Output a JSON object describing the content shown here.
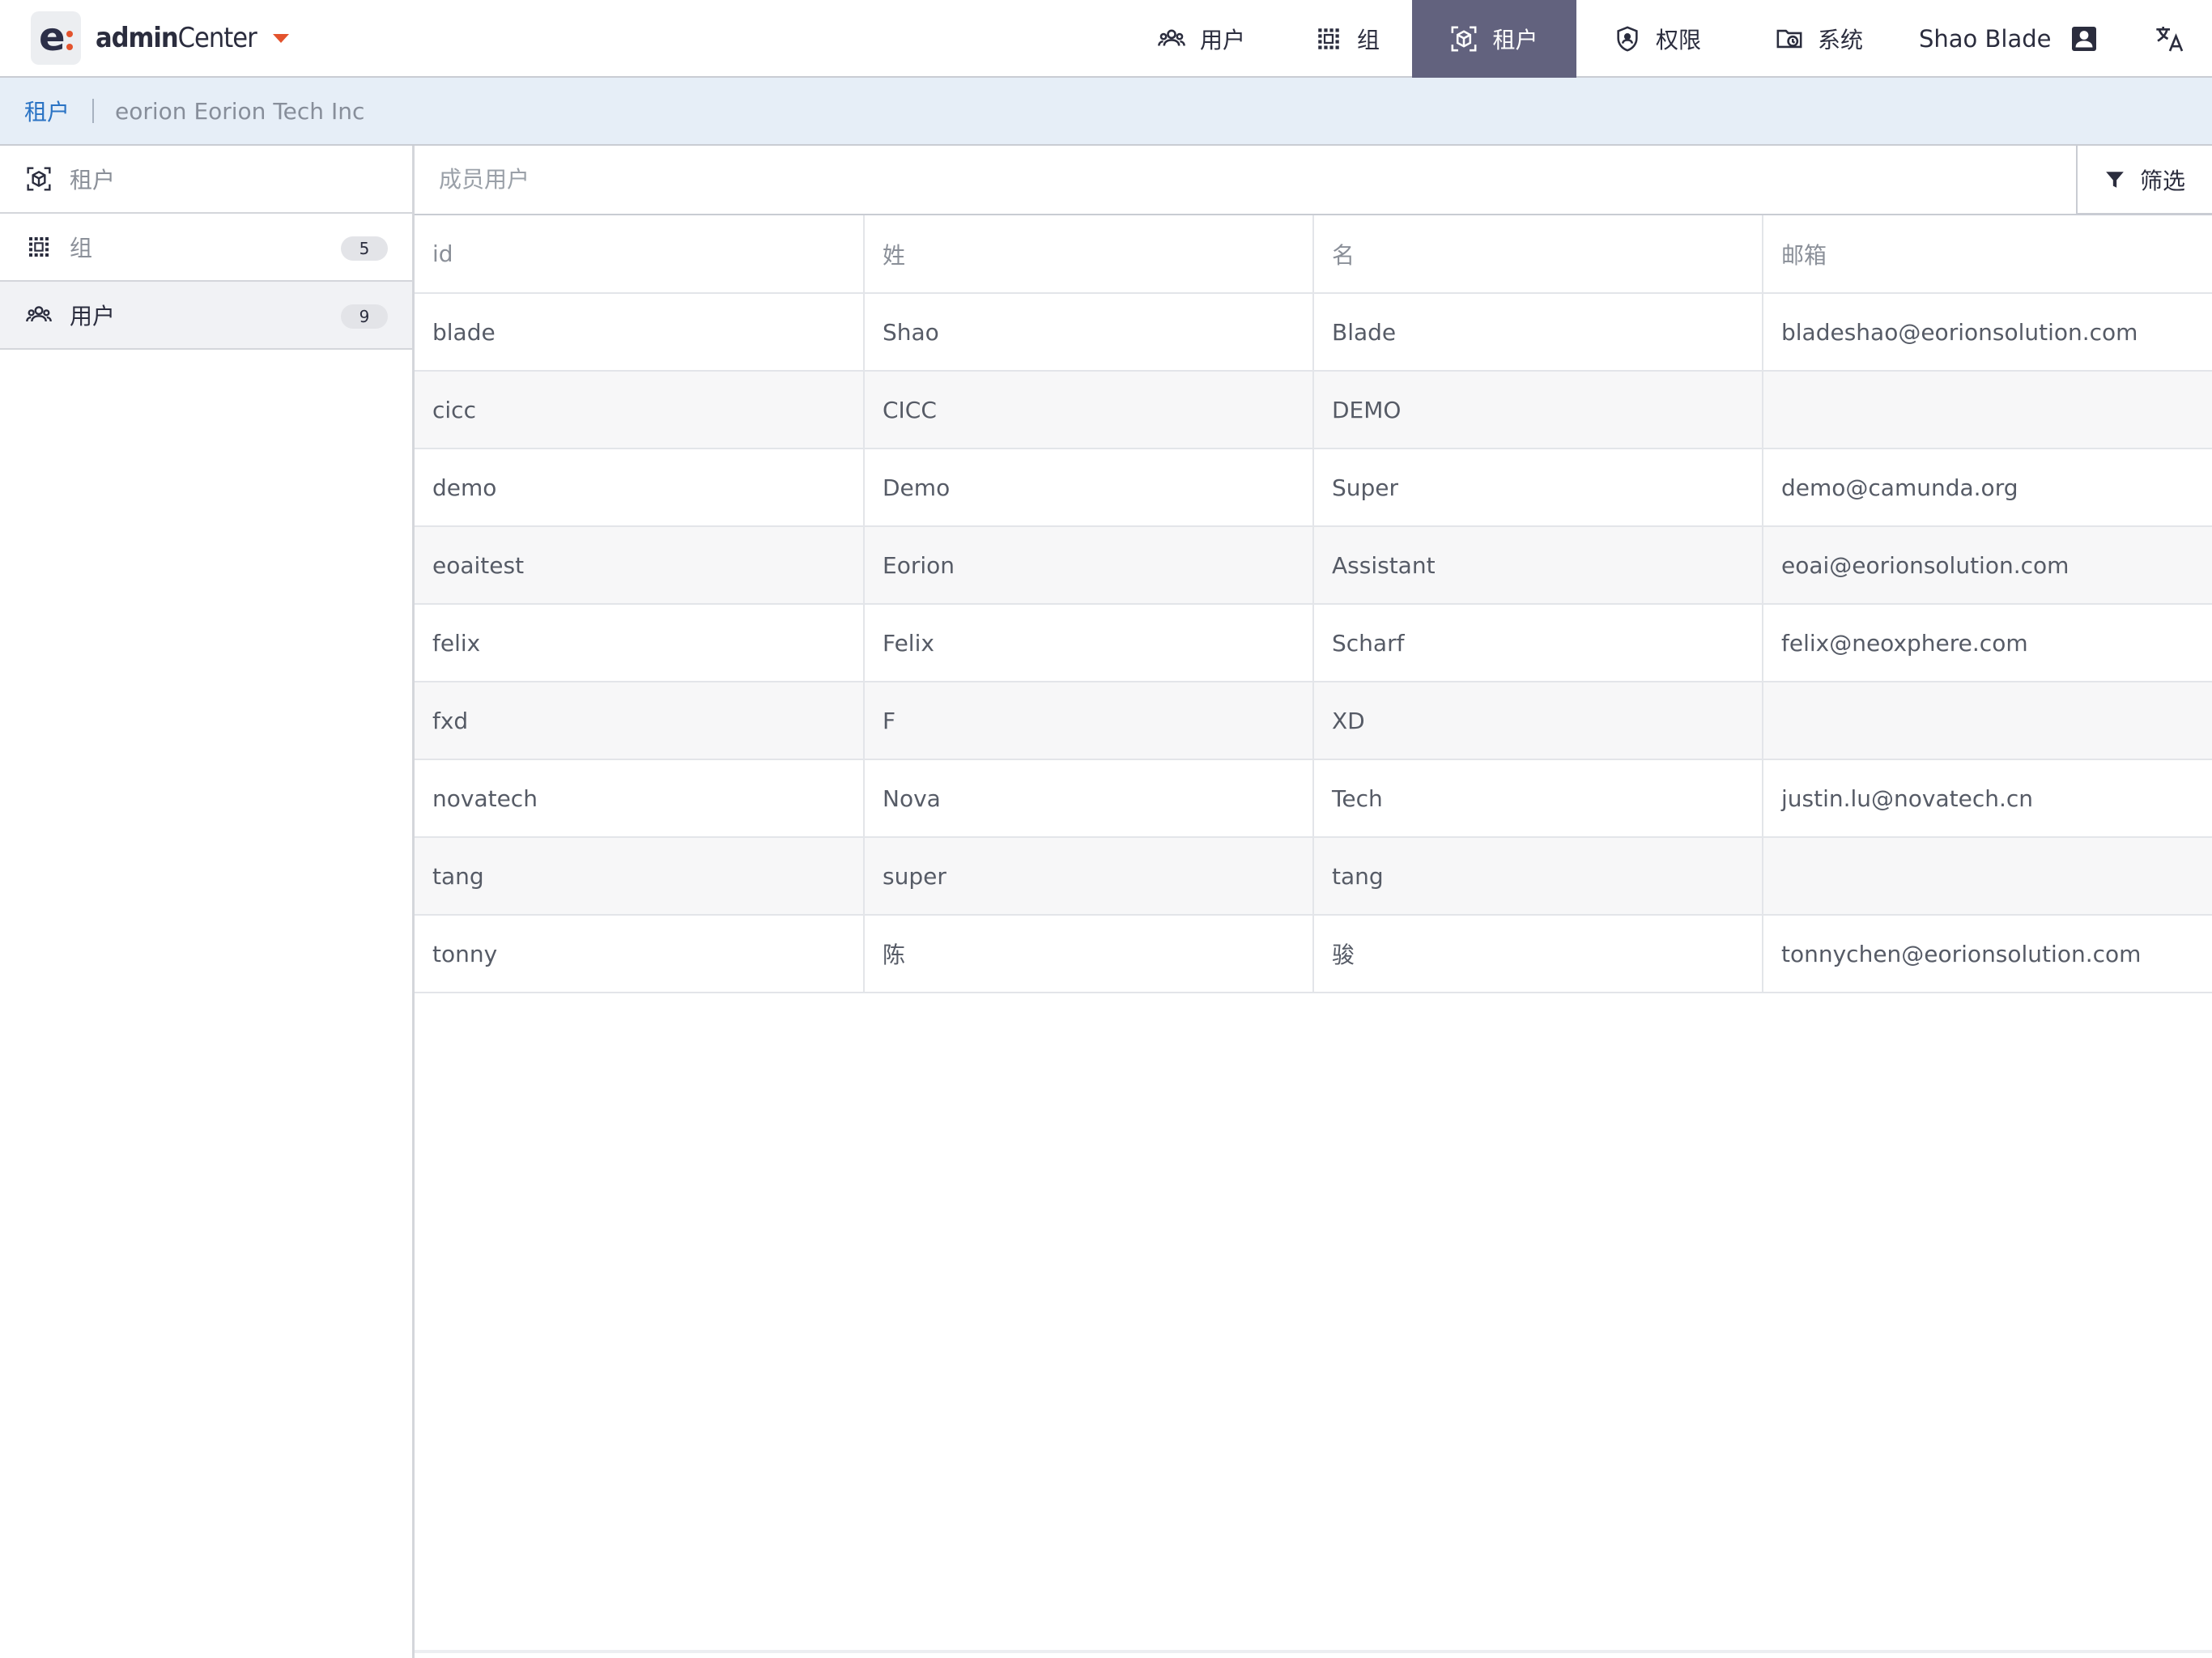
{
  "header": {
    "brand_prefix": "admin",
    "brand_suffix": "Center",
    "nav": [
      {
        "label": "用户",
        "icon": "users-icon"
      },
      {
        "label": "组",
        "icon": "group-grid-icon"
      },
      {
        "label": "租户",
        "icon": "tenant-cube-icon",
        "active": true
      },
      {
        "label": "权限",
        "icon": "shield-icon"
      },
      {
        "label": "系统",
        "icon": "system-folder-icon"
      }
    ],
    "user_name": "Shao Blade",
    "accent_color": "#62627e",
    "brand_accent": "#e3532d"
  },
  "breadcrumb": {
    "parent": "租户",
    "current": "eorion Eorion Tech Inc"
  },
  "sidebar": {
    "items": [
      {
        "label": "租户",
        "icon": "tenant-cube-icon"
      },
      {
        "label": "组",
        "icon": "group-grid-icon",
        "count": "5"
      },
      {
        "label": "用户",
        "icon": "users-icon",
        "count": "9",
        "active": true
      }
    ]
  },
  "main": {
    "search_placeholder": "成员用户",
    "filter_label": "筛选",
    "columns": [
      "id",
      "姓",
      "名",
      "邮箱"
    ],
    "rows": [
      [
        "blade",
        "Shao",
        "Blade",
        "bladeshao@eorionsolution.com"
      ],
      [
        "cicc",
        "CICC",
        "DEMO",
        ""
      ],
      [
        "demo",
        "Demo",
        "Super",
        "demo@camunda.org"
      ],
      [
        "eoaitest",
        "Eorion",
        "Assistant",
        "eoai@eorionsolution.com"
      ],
      [
        "felix",
        "Felix",
        "Scharf",
        "felix@neoxphere.com"
      ],
      [
        "fxd",
        "F",
        "XD",
        ""
      ],
      [
        "novatech",
        "Nova",
        "Tech",
        "justin.lu@novatech.cn"
      ],
      [
        "tang",
        "super",
        "tang",
        ""
      ],
      [
        "tonny",
        "陈",
        "骏",
        "tonnychen@eorionsolution.com"
      ]
    ]
  }
}
